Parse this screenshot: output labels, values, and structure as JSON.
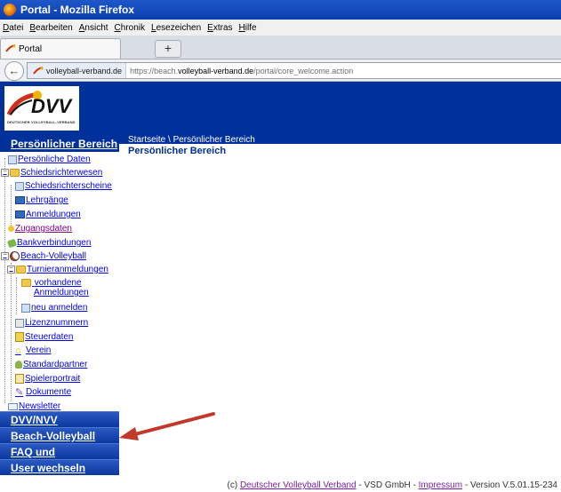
{
  "window": {
    "title": "Portal - Mozilla Firefox"
  },
  "menubar": [
    "Datei",
    "Bearbeiten",
    "Ansicht",
    "Chronik",
    "Lesezeichen",
    "Extras",
    "Hilfe"
  ],
  "browser": {
    "tab_label": "Portal",
    "new_tab_symbol": "+",
    "site_identity": "volleyball-verband.de",
    "url_prefix": "https://beach.",
    "url_domain": "volleyball-verband.de",
    "url_path": "/portal/core_welcome.action"
  },
  "header": {
    "logo_text": "DVV",
    "logo_subtext": "DEUTSCHER VOLLEYBALL-VERBAND"
  },
  "sidebar": {
    "heading": "Persönlicher Bereich",
    "items": [
      {
        "label": "Persönliche Daten",
        "icon": "id-card-icon"
      },
      {
        "label": "Schiedsrichterwesen",
        "icon": "folder-icon"
      },
      {
        "label": "Schiedsrichterscheine",
        "icon": "document-icon"
      },
      {
        "label": "Lehrgänge",
        "icon": "book-icon"
      },
      {
        "label": "Anmeldungen",
        "icon": "book-icon"
      },
      {
        "label": "Zugangsdaten",
        "icon": "key-icon"
      },
      {
        "label": "Bankverbindungen",
        "icon": "money-icon"
      },
      {
        "label": "Beach-Volleyball",
        "icon": "ball-icon"
      },
      {
        "label": "Turnieranmeldungen",
        "icon": "folder-icon"
      },
      {
        "label": "vorhandene",
        "label2": "Anmeldungen",
        "icon": "folder-icon"
      },
      {
        "label": "neu anmelden",
        "icon": "document-icon"
      },
      {
        "label": "Lizenznummern",
        "icon": "id-card-icon"
      },
      {
        "label": "Steuerdaten",
        "icon": "document-icon"
      },
      {
        "label": "Verein",
        "icon": "house-icon"
      },
      {
        "label": "Standardpartner",
        "icon": "person-icon"
      },
      {
        "label": "Spielerportrait",
        "icon": "portrait-icon"
      },
      {
        "label": "Dokumente",
        "icon": "pen-icon"
      },
      {
        "label": "Newsletter",
        "icon": "mail-icon"
      }
    ],
    "sections": [
      "DVV/NVV",
      "Beach-Volleyball",
      "FAQ und Anleitungen",
      "User wechseln"
    ]
  },
  "main": {
    "breadcrumb": "Startseite \\ Persönlicher Bereich",
    "title": "Persönlicher Bereich"
  },
  "footer": {
    "prefix": "(c) ",
    "link1": "Deutscher Volleyball Verband",
    "middle": " - VSD GmbH - ",
    "link2": "Impressum",
    "suffix": " - Version V.5.01.15-234"
  },
  "colors": {
    "brand_blue": "#00309a",
    "arrow_red": "#c0392b",
    "visited": "#800080"
  }
}
